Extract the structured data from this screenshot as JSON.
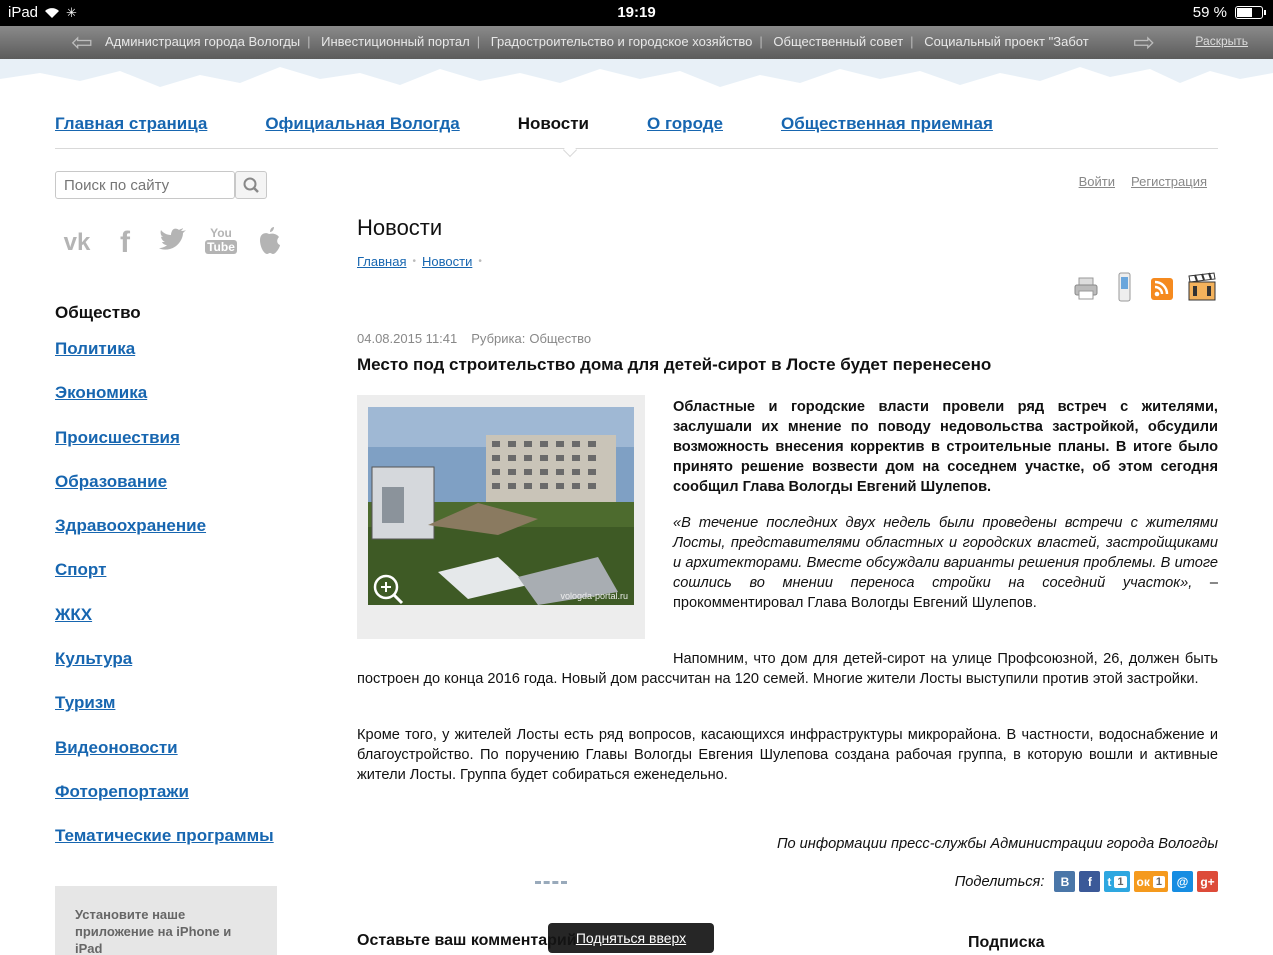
{
  "status_bar": {
    "device": "iPad",
    "time": "19:19",
    "battery": "59 %"
  },
  "portal_bar": {
    "links": [
      "Администрация города Вологды",
      "Инвестиционный портал",
      "Градостроительство и городское хозяйство",
      "Общественный совет",
      "Социальный проект \"Забот"
    ],
    "expand_label": "Раскрыть"
  },
  "main_nav": {
    "items": [
      "Главная страница",
      "Официальная Вологда",
      "Новости",
      "О городе",
      "Общественная приемная"
    ],
    "active_index": 2
  },
  "search": {
    "placeholder": "Поиск по сайту"
  },
  "auth": {
    "login": "Войти",
    "register": "Регистрация"
  },
  "social_icons": [
    "vk-icon",
    "facebook-icon",
    "twitter-icon",
    "youtube-icon",
    "apple-icon"
  ],
  "sidebar": {
    "title": "Общество",
    "items": [
      "Политика",
      "Экономика",
      "Происшествия",
      "Образование",
      "Здравоохранение",
      "Спорт",
      "ЖКХ",
      "Культура",
      "Туризм",
      "Видеоновости",
      "Фоторепортажи",
      "Тематические программы"
    ],
    "app_promo": "Установите наше приложение на iPhone и iPad"
  },
  "content": {
    "page_title": "Новости",
    "breadcrumbs": [
      "Главная",
      "Новости"
    ],
    "tools": [
      "print-icon",
      "mobile-icon",
      "rss-icon",
      "video-icon"
    ],
    "date": "04.08.2015 11:41",
    "rubric_label": "Рубрика:",
    "rubric_value": "Общество",
    "headline": "Место под строительство дома для детей-сирот в Лосте будет перенесено",
    "photo_watermark": "vologda-portal.ru",
    "lead": "Областные и городские власти провели ряд встреч с жителями, заслушали их мнение по поводу недовольства застройкой, обсудили возможность внесения корректив в строительные планы. В итоге было принято решение возвести дом на соседнем участке, об этом сегодня сообщил Глава Вологды Евгений Шулепов.",
    "quote_italic": "«В течение последних двух недель были проведены встречи с жителями Лосты, представителями областных и городских властей, застройщиками и архитекторами. Вместе обсуждали варианты решения проблемы. В итоге сошлись во мнении переноса стройки на соседний участок»,",
    "quote_attribution": " – прокомментировал Глава Вологды Евгений Шулепов.",
    "paragraph_1": "Напомним, что дом для детей-сирот на улице Профсоюзной, 26, должен быть построен до конца 2016 года. Новый дом рассчитан на 120 семей. Многие жители Лосты выступили против этой застройки.",
    "paragraph_2": "Кроме того, у жителей Лосты есть ряд вопросов, касающихся инфраструктуры микрорайона. В частности, водоснабжение и благоустройство. По поручению Главы Вологды Евгения Шулепова создана рабочая группа, в которую вошли и активные жители Лосты. Группа будет собираться еженедельно.",
    "source": "По информации пресс-службы Администрации города Вологды"
  },
  "share": {
    "label": "Поделиться:",
    "buttons": [
      {
        "name": "vk",
        "glyph": "В",
        "count": "",
        "color": "#4a76a8"
      },
      {
        "name": "facebook",
        "glyph": "f",
        "count": "",
        "color": "#3b5998"
      },
      {
        "name": "twitter",
        "glyph": "t",
        "count": "1",
        "color": "#2ea7e0"
      },
      {
        "name": "odnoklassniki",
        "glyph": "ок",
        "count": "1",
        "color": "#f59a1d"
      },
      {
        "name": "mail",
        "glyph": "@",
        "count": "",
        "color": "#168de2"
      },
      {
        "name": "googleplus",
        "glyph": "g+",
        "count": "",
        "color": "#dd4b39"
      }
    ]
  },
  "comments": {
    "title": "Оставьте ваш комментарий"
  },
  "subscribe": {
    "title": "Подписка"
  },
  "to_top": {
    "label": "Подняться вверх"
  }
}
